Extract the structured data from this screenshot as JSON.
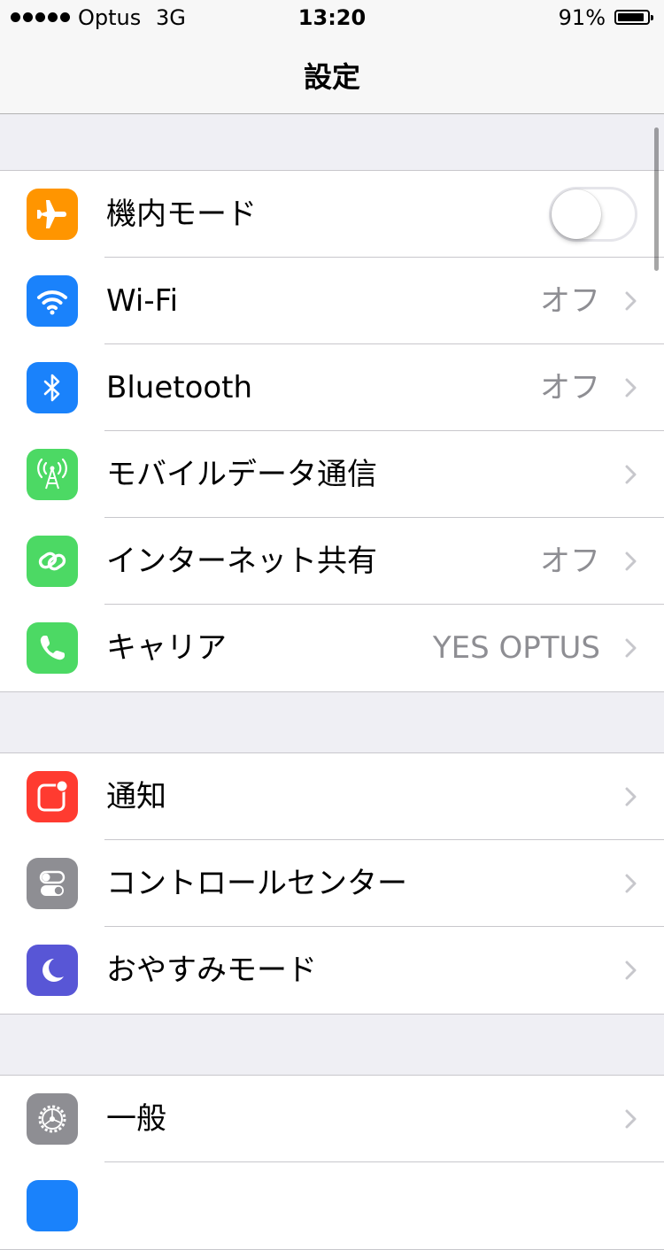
{
  "status_bar": {
    "carrier": "Optus",
    "network": "3G",
    "time": "13:20",
    "battery_percent": "91%",
    "battery_level": 0.91
  },
  "nav": {
    "title": "設定"
  },
  "groups": [
    {
      "rows": [
        {
          "label": "機内モード",
          "icon": "airplane-icon",
          "icon_color": "#ff9500",
          "toggle": false
        },
        {
          "label": "Wi-Fi",
          "icon": "wifi-icon",
          "icon_color": "#1a82fb",
          "detail": "オフ"
        },
        {
          "label": "Bluetooth",
          "icon": "bluetooth-icon",
          "icon_color": "#1a82fb",
          "detail": "オフ"
        },
        {
          "label": "モバイルデータ通信",
          "icon": "cellular-antenna-icon",
          "icon_color": "#4cd964"
        },
        {
          "label": "インターネット共有",
          "icon": "hotspot-chain-icon",
          "icon_color": "#4cd964",
          "detail": "オフ"
        },
        {
          "label": "キャリア",
          "icon": "phone-icon",
          "icon_color": "#4cd964",
          "detail": "YES OPTUS"
        }
      ]
    },
    {
      "rows": [
        {
          "label": "通知",
          "icon": "notifications-icon",
          "icon_color": "#ff3b30"
        },
        {
          "label": "コントロールセンター",
          "icon": "control-center-icon",
          "icon_color": "#8e8e93"
        },
        {
          "label": "おやすみモード",
          "icon": "moon-icon",
          "icon_color": "#5856d6"
        }
      ]
    },
    {
      "rows": [
        {
          "label": "一般",
          "icon": "gear-icon",
          "icon_color": "#8e8e93"
        }
      ]
    }
  ],
  "colors": {
    "background": "#efeff4",
    "separator": "#c8c7cc",
    "detail_text": "#8e8e93",
    "chevron": "#c7c7cc"
  }
}
